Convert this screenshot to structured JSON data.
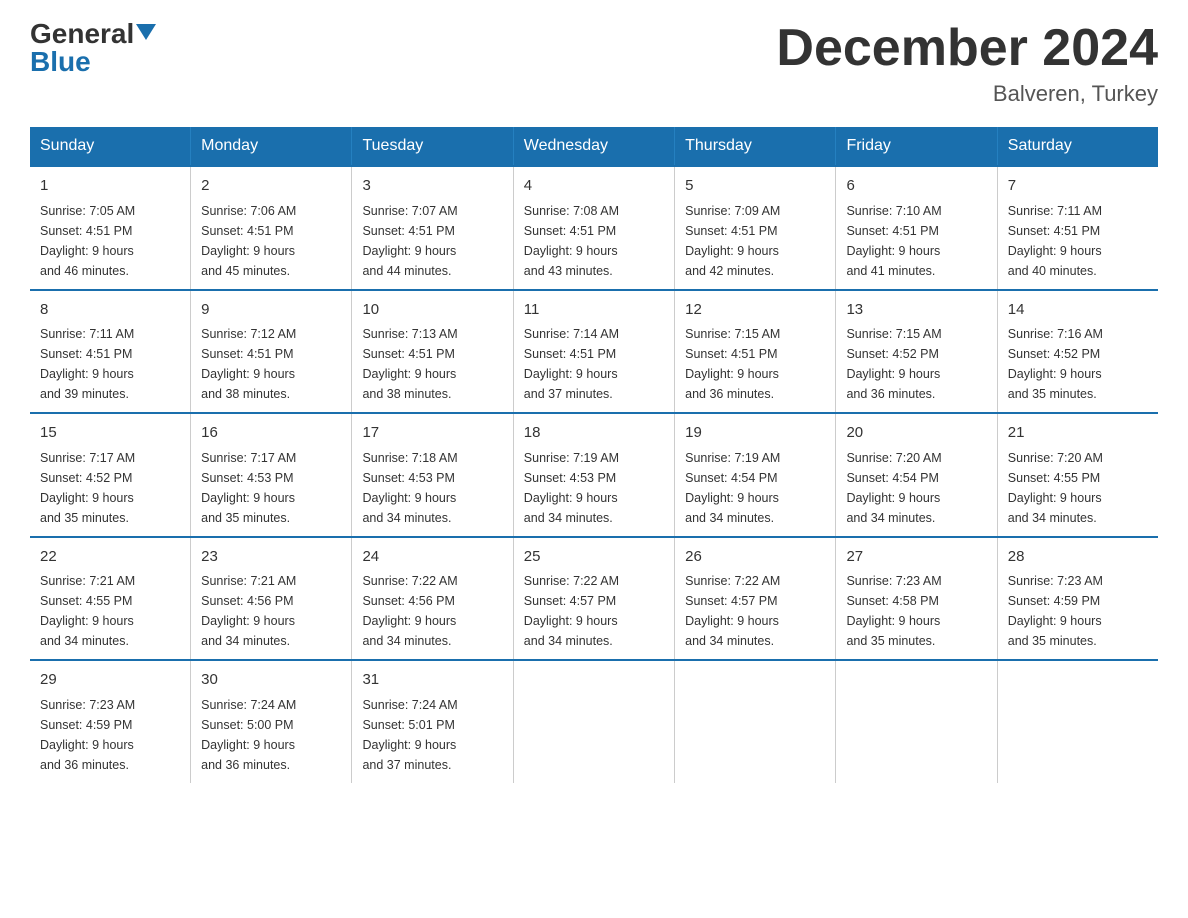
{
  "logo": {
    "general": "General",
    "blue": "Blue"
  },
  "title": "December 2024",
  "subtitle": "Balveren, Turkey",
  "days_of_week": [
    "Sunday",
    "Monday",
    "Tuesday",
    "Wednesday",
    "Thursday",
    "Friday",
    "Saturday"
  ],
  "weeks": [
    [
      {
        "day": "1",
        "sunrise": "7:05 AM",
        "sunset": "4:51 PM",
        "daylight": "9 hours and 46 minutes."
      },
      {
        "day": "2",
        "sunrise": "7:06 AM",
        "sunset": "4:51 PM",
        "daylight": "9 hours and 45 minutes."
      },
      {
        "day": "3",
        "sunrise": "7:07 AM",
        "sunset": "4:51 PM",
        "daylight": "9 hours and 44 minutes."
      },
      {
        "day": "4",
        "sunrise": "7:08 AM",
        "sunset": "4:51 PM",
        "daylight": "9 hours and 43 minutes."
      },
      {
        "day": "5",
        "sunrise": "7:09 AM",
        "sunset": "4:51 PM",
        "daylight": "9 hours and 42 minutes."
      },
      {
        "day": "6",
        "sunrise": "7:10 AM",
        "sunset": "4:51 PM",
        "daylight": "9 hours and 41 minutes."
      },
      {
        "day": "7",
        "sunrise": "7:11 AM",
        "sunset": "4:51 PM",
        "daylight": "9 hours and 40 minutes."
      }
    ],
    [
      {
        "day": "8",
        "sunrise": "7:11 AM",
        "sunset": "4:51 PM",
        "daylight": "9 hours and 39 minutes."
      },
      {
        "day": "9",
        "sunrise": "7:12 AM",
        "sunset": "4:51 PM",
        "daylight": "9 hours and 38 minutes."
      },
      {
        "day": "10",
        "sunrise": "7:13 AM",
        "sunset": "4:51 PM",
        "daylight": "9 hours and 38 minutes."
      },
      {
        "day": "11",
        "sunrise": "7:14 AM",
        "sunset": "4:51 PM",
        "daylight": "9 hours and 37 minutes."
      },
      {
        "day": "12",
        "sunrise": "7:15 AM",
        "sunset": "4:51 PM",
        "daylight": "9 hours and 36 minutes."
      },
      {
        "day": "13",
        "sunrise": "7:15 AM",
        "sunset": "4:52 PM",
        "daylight": "9 hours and 36 minutes."
      },
      {
        "day": "14",
        "sunrise": "7:16 AM",
        "sunset": "4:52 PM",
        "daylight": "9 hours and 35 minutes."
      }
    ],
    [
      {
        "day": "15",
        "sunrise": "7:17 AM",
        "sunset": "4:52 PM",
        "daylight": "9 hours and 35 minutes."
      },
      {
        "day": "16",
        "sunrise": "7:17 AM",
        "sunset": "4:53 PM",
        "daylight": "9 hours and 35 minutes."
      },
      {
        "day": "17",
        "sunrise": "7:18 AM",
        "sunset": "4:53 PM",
        "daylight": "9 hours and 34 minutes."
      },
      {
        "day": "18",
        "sunrise": "7:19 AM",
        "sunset": "4:53 PM",
        "daylight": "9 hours and 34 minutes."
      },
      {
        "day": "19",
        "sunrise": "7:19 AM",
        "sunset": "4:54 PM",
        "daylight": "9 hours and 34 minutes."
      },
      {
        "day": "20",
        "sunrise": "7:20 AM",
        "sunset": "4:54 PM",
        "daylight": "9 hours and 34 minutes."
      },
      {
        "day": "21",
        "sunrise": "7:20 AM",
        "sunset": "4:55 PM",
        "daylight": "9 hours and 34 minutes."
      }
    ],
    [
      {
        "day": "22",
        "sunrise": "7:21 AM",
        "sunset": "4:55 PM",
        "daylight": "9 hours and 34 minutes."
      },
      {
        "day": "23",
        "sunrise": "7:21 AM",
        "sunset": "4:56 PM",
        "daylight": "9 hours and 34 minutes."
      },
      {
        "day": "24",
        "sunrise": "7:22 AM",
        "sunset": "4:56 PM",
        "daylight": "9 hours and 34 minutes."
      },
      {
        "day": "25",
        "sunrise": "7:22 AM",
        "sunset": "4:57 PM",
        "daylight": "9 hours and 34 minutes."
      },
      {
        "day": "26",
        "sunrise": "7:22 AM",
        "sunset": "4:57 PM",
        "daylight": "9 hours and 34 minutes."
      },
      {
        "day": "27",
        "sunrise": "7:23 AM",
        "sunset": "4:58 PM",
        "daylight": "9 hours and 35 minutes."
      },
      {
        "day": "28",
        "sunrise": "7:23 AM",
        "sunset": "4:59 PM",
        "daylight": "9 hours and 35 minutes."
      }
    ],
    [
      {
        "day": "29",
        "sunrise": "7:23 AM",
        "sunset": "4:59 PM",
        "daylight": "9 hours and 36 minutes."
      },
      {
        "day": "30",
        "sunrise": "7:24 AM",
        "sunset": "5:00 PM",
        "daylight": "9 hours and 36 minutes."
      },
      {
        "day": "31",
        "sunrise": "7:24 AM",
        "sunset": "5:01 PM",
        "daylight": "9 hours and 37 minutes."
      },
      null,
      null,
      null,
      null
    ]
  ],
  "labels": {
    "sunrise": "Sunrise:",
    "sunset": "Sunset:",
    "daylight": "Daylight:"
  }
}
